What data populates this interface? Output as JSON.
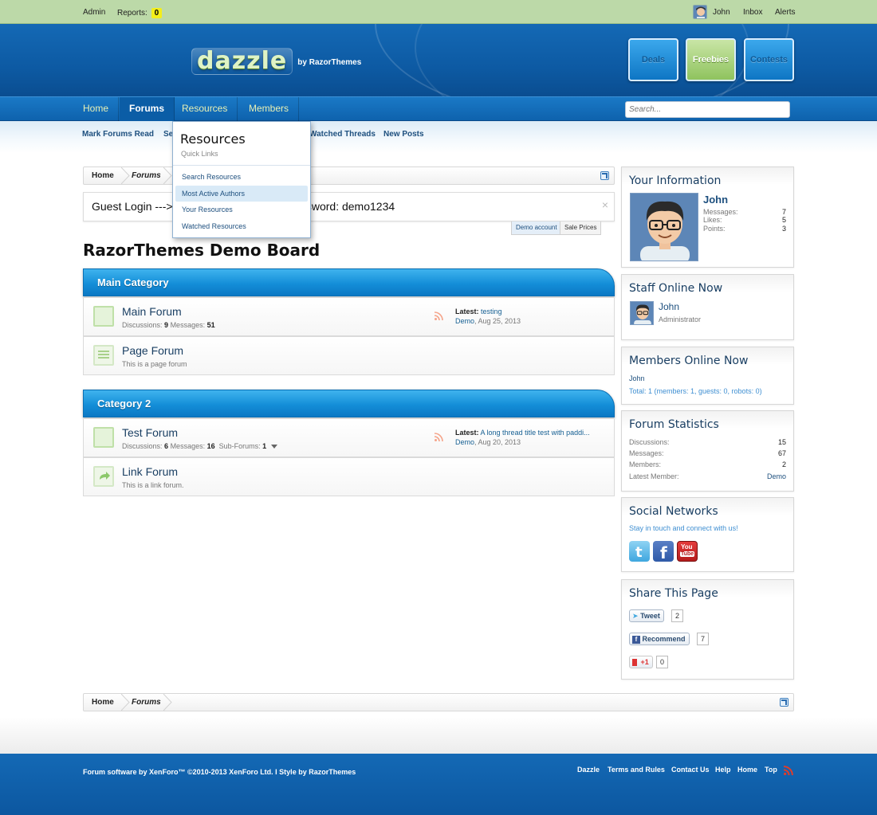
{
  "admin_bar": {
    "admin": "Admin",
    "reports_label": "Reports:",
    "reports_count": "0",
    "user": "John",
    "inbox": "Inbox",
    "alerts": "Alerts"
  },
  "header": {
    "logo_word": "dazzle",
    "logo_by": "by RazorThemes",
    "buttons": [
      "Deals",
      "Freebies",
      "Contests"
    ]
  },
  "nav": {
    "tabs": [
      "Home",
      "Forums",
      "Resources",
      "Members"
    ],
    "selected": "Forums",
    "search_placeholder": "Search..."
  },
  "subnav": [
    "Mark Forums Read",
    "Se",
    "Watched Threads",
    "New Posts"
  ],
  "breadcrumb": [
    "Home",
    "Forums"
  ],
  "notice": {
    "text": "Guest Login ---> Username: Demo and password: demo1234",
    "close": "×",
    "tabs": [
      "Demo account",
      "Sale Prices"
    ]
  },
  "board_title": "RazorThemes Demo Board",
  "categories": [
    {
      "title": "Main Category",
      "nodes": [
        {
          "title": "Main Forum",
          "discussions_label": "Discussions:",
          "discussions": "9",
          "messages_label": "Messages:",
          "messages": "51",
          "latest_label": "Latest:",
          "latest_title": "testing",
          "latest_user": "Demo",
          "latest_date": ", Aug 25, 2013"
        },
        {
          "title": "Page Forum",
          "description": "This is a page forum"
        }
      ]
    },
    {
      "title": "Category 2",
      "nodes": [
        {
          "title": "Test Forum",
          "discussions_label": "Discussions:",
          "discussions": "6",
          "messages_label": "Messages:",
          "messages": "16",
          "subforums_label": "Sub-Forums:",
          "subforums": "1",
          "latest_label": "Latest:",
          "latest_title": "A long thread title test with paddi...",
          "latest_user": "Demo",
          "latest_date": ", Aug 20, 2013"
        },
        {
          "title": "Link Forum",
          "description": "This is a link forum."
        }
      ]
    }
  ],
  "resources_menu": {
    "title": "Resources",
    "subtitle": "Quick Links",
    "items": [
      "Search Resources",
      "Most Active Authors",
      "Your Resources",
      "Watched Resources"
    ],
    "hovered": "Most Active Authors"
  },
  "sidebar": {
    "your_info": {
      "title": "Your Information",
      "name": "John",
      "messages_label": "Messages:",
      "messages": "7",
      "likes_label": "Likes:",
      "likes": "5",
      "points_label": "Points:",
      "points": "3"
    },
    "staff": {
      "title": "Staff Online Now",
      "name": "John",
      "role": "Administrator"
    },
    "members_online": {
      "title": "Members Online Now",
      "name": "John",
      "total": "Total: 1 (members: 1, guests: 0, robots: 0)"
    },
    "stats": {
      "title": "Forum Statistics",
      "rows": [
        {
          "label": "Discussions:",
          "value": "15"
        },
        {
          "label": "Messages:",
          "value": "67"
        },
        {
          "label": "Members:",
          "value": "2"
        },
        {
          "label": "Latest Member:",
          "value": "Demo"
        }
      ]
    },
    "social": {
      "title": "Social Networks",
      "tagline": "Stay in touch and connect with us!",
      "icons": [
        "twitter-icon",
        "facebook-icon",
        "youtube-icon"
      ],
      "youtube_text": [
        "You",
        "Tube"
      ]
    },
    "share": {
      "title": "Share This Page",
      "tweet_label": "Tweet",
      "tweet_count": "2",
      "recommend_label": "Recommend",
      "recommend_count": "7",
      "plusone_label": "+1",
      "plusone_count": "0"
    }
  },
  "footer": {
    "copyright": "Forum software by XenForo™ ©2010-2013 XenForo Ltd. I Style by RazorThemes",
    "links": [
      "Dazzle",
      "Terms and Rules",
      "Contact Us",
      "Help",
      "Home",
      "Top"
    ]
  },
  "colors": {
    "header_blue": "#0d5aa3",
    "admin_bar_green": "#bcd9a8",
    "category_blue": "#148ed8",
    "link_blue": "#176093",
    "freebies_green": "#8fc35e",
    "reports_yellow": "#f4ee1a"
  }
}
